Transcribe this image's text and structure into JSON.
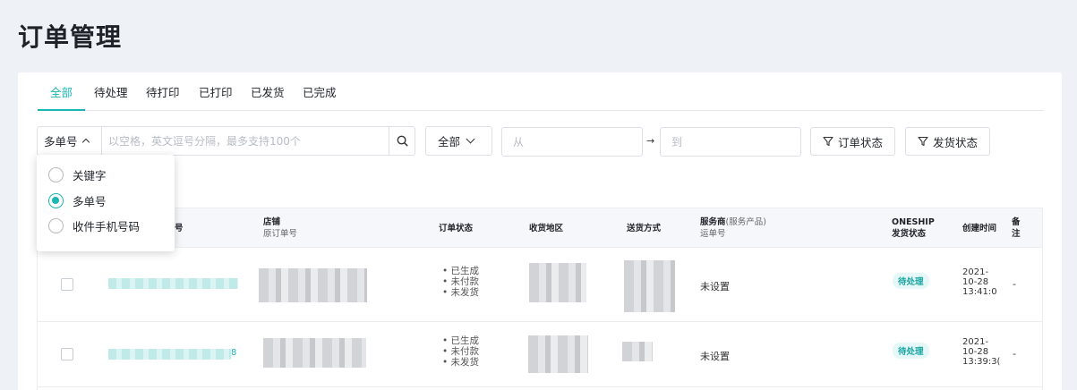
{
  "page_title": "订单管理",
  "tabs": [
    {
      "label": "全部",
      "active": true
    },
    {
      "label": "待处理",
      "active": false
    },
    {
      "label": "待打印",
      "active": false
    },
    {
      "label": "已打印",
      "active": false
    },
    {
      "label": "已发货",
      "active": false
    },
    {
      "label": "已完成",
      "active": false
    }
  ],
  "search": {
    "type_label": "多单号",
    "placeholder": "以空格，英文逗号分隔，最多支持100个"
  },
  "select_all_label": "全部",
  "date_from_placeholder": "从",
  "date_to_placeholder": "到",
  "date_arrow": "→",
  "filters": {
    "order_status": "订单状态",
    "ship_status": "发货状态"
  },
  "dropdown": {
    "options": [
      {
        "label": "关键字",
        "selected": false
      },
      {
        "label": "多单号",
        "selected": true
      },
      {
        "label": "收件手机号码",
        "selected": false
      }
    ]
  },
  "table": {
    "headers": {
      "order_no_tail": "号",
      "store": "店铺",
      "store_sub": "原订单号",
      "order_status": "订单状态",
      "region": "收货地区",
      "delivery": "送货方式",
      "provider": "服务商",
      "provider_paren": "(服务产品)",
      "provider_sub": "运单号",
      "oneship": "ONESHIP",
      "oneship_sub": "发货状态",
      "created": "创建时间",
      "remark1": "备",
      "remark2": "注"
    },
    "rows": [
      {
        "link_tail": "",
        "statuses": [
          "• 已生成",
          "• 未付款",
          "• 未发货"
        ],
        "provider": "未设置",
        "badge": "待处理",
        "time": [
          "2021-",
          "10-28",
          "13:41:0"
        ],
        "remark": "-"
      },
      {
        "link_tail": "8",
        "statuses": [
          "• 已生成",
          "• 未付款",
          "• 未发货"
        ],
        "provider": "未设置",
        "badge": "待处理",
        "time": [
          "2021-",
          "10-28",
          "13:39:3("
        ],
        "remark": "-"
      }
    ]
  },
  "colors": {
    "accent": "#19b6b4",
    "background": "#eef1f5"
  }
}
